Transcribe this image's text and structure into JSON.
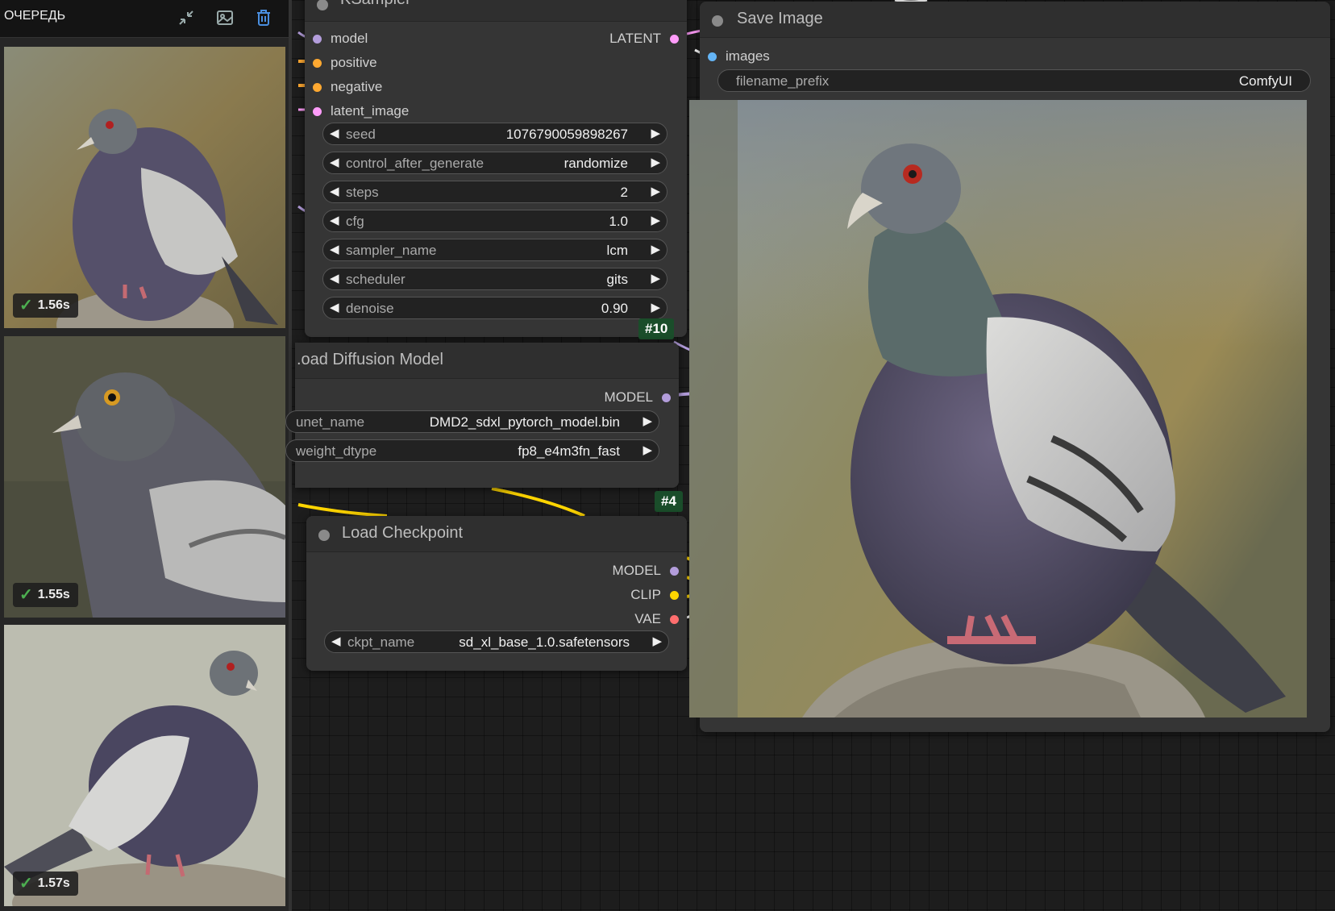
{
  "queue": {
    "title": "ОЧЕРЕДЬ",
    "icons": [
      "collapse-icon",
      "image-gallery-icon",
      "trash-icon"
    ],
    "items": [
      {
        "time": "1.56s",
        "status": "check-icon"
      },
      {
        "time": "1.55s",
        "status": "check-icon"
      },
      {
        "time": "1.57s",
        "status": "check-icon"
      }
    ]
  },
  "ksampler": {
    "title": "KSampler",
    "inputs": [
      "model",
      "positive",
      "negative",
      "latent_image"
    ],
    "output": "LATENT",
    "widgets": [
      {
        "name": "seed",
        "value": "1076790059898267"
      },
      {
        "name": "control_after_generate",
        "value": "randomize"
      },
      {
        "name": "steps",
        "value": "2"
      },
      {
        "name": "cfg",
        "value": "1.0"
      },
      {
        "name": "sampler_name",
        "value": "lcm"
      },
      {
        "name": "scheduler",
        "value": "gits"
      },
      {
        "name": "denoise",
        "value": "0.90"
      }
    ],
    "id": "#10"
  },
  "load_diffusion": {
    "title": ".oad Diffusion Model",
    "output": "MODEL",
    "widgets": [
      {
        "name": "unet_name",
        "value": "DMD2_sdxl_pytorch_model.bin"
      },
      {
        "name": "weight_dtype",
        "value": "fp8_e4m3fn_fast"
      }
    ],
    "id": "#4"
  },
  "load_checkpoint": {
    "title": "Load Checkpoint",
    "outputs": [
      "MODEL",
      "CLIP",
      "VAE"
    ],
    "widgets": [
      {
        "name": "ckpt_name",
        "value": "sd_xl_base_1.0.safetensors"
      }
    ]
  },
  "save_image": {
    "title": "Save Image",
    "input": "images",
    "widgets": [
      {
        "name": "filename_prefix",
        "value": "ComfyUI"
      }
    ]
  },
  "colors": {
    "model": "#b39ddb",
    "conditioning": "#ffa931",
    "latent": "#ff9cf9",
    "clip": "#ffd500",
    "vae": "#ff6e6e",
    "image": "#64b5f6",
    "badge_check": "#4caf50",
    "node_id_bg": "#1a4d2a"
  }
}
